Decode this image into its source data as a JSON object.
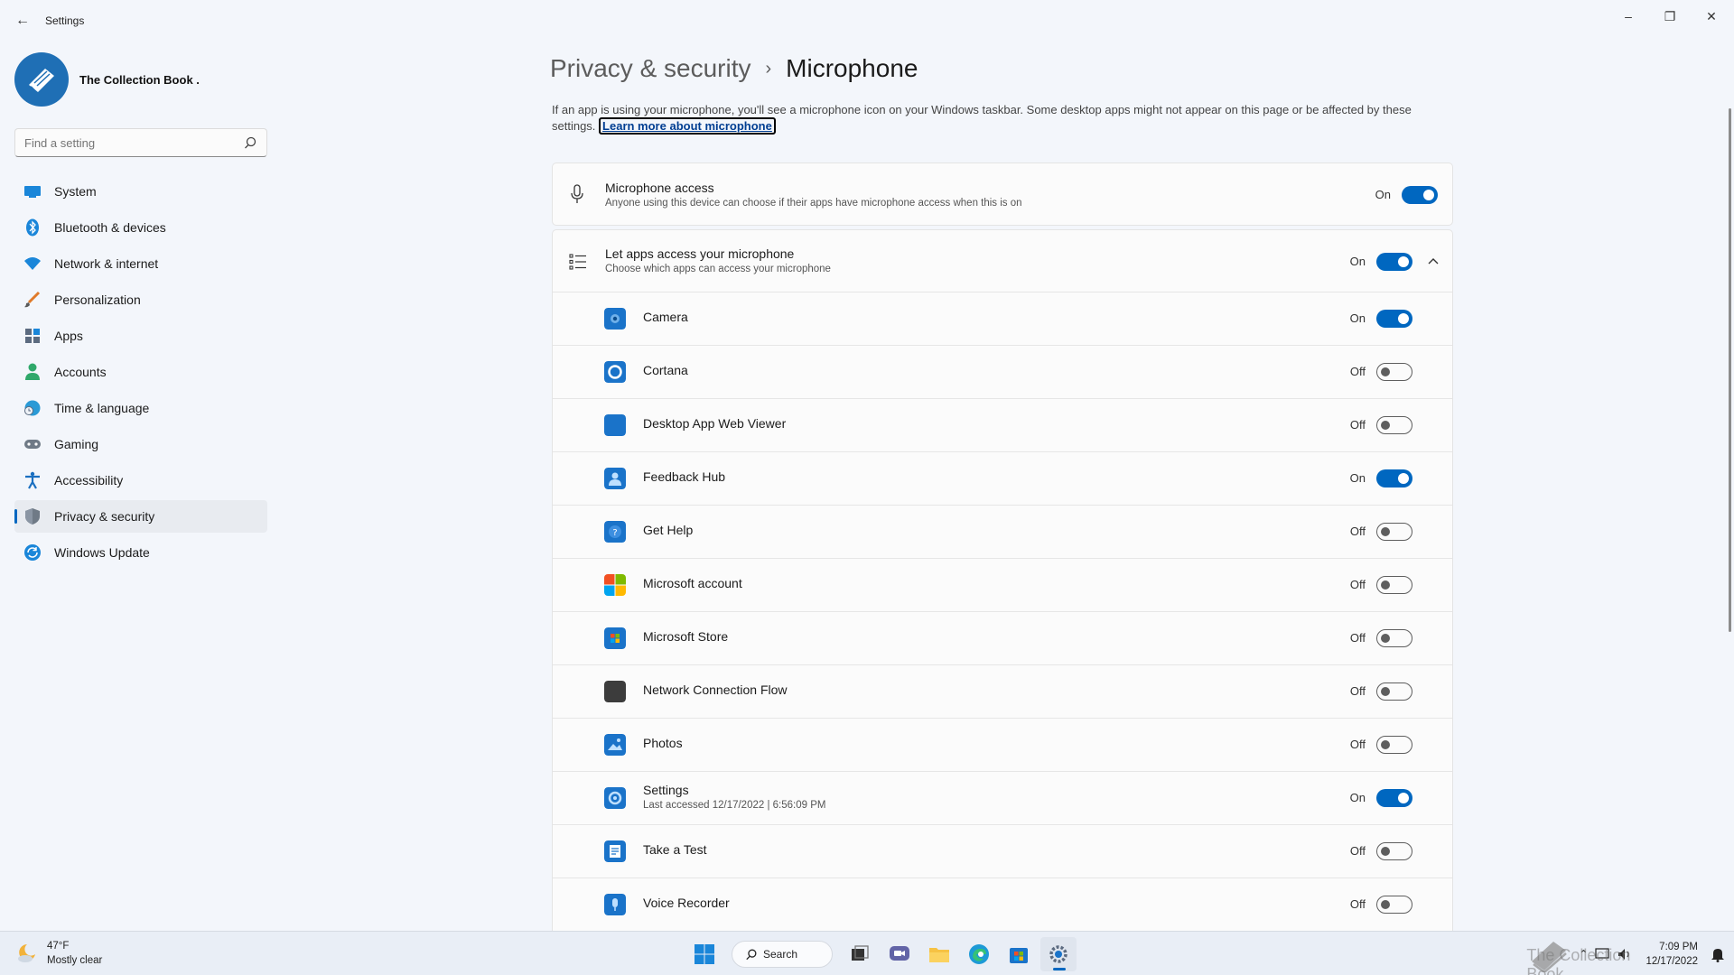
{
  "window": {
    "title": "Settings",
    "controls": {
      "minimize": "–",
      "restore": "❐",
      "close": "✕"
    }
  },
  "profile": {
    "name": "The Collection Book ."
  },
  "search": {
    "placeholder": "Find a setting"
  },
  "nav": {
    "items": [
      {
        "label": "System",
        "icon": "monitor-icon",
        "color": "#1a86d9"
      },
      {
        "label": "Bluetooth & devices",
        "icon": "bluetooth-icon",
        "color": "#1a86d9"
      },
      {
        "label": "Network & internet",
        "icon": "wifi-icon",
        "color": "#1a86d9"
      },
      {
        "label": "Personalization",
        "icon": "brush-icon",
        "color": "#e07a2a"
      },
      {
        "label": "Apps",
        "icon": "apps-icon",
        "color": "#5c6b80"
      },
      {
        "label": "Accounts",
        "icon": "person-icon",
        "color": "#2fa86a"
      },
      {
        "label": "Time & language",
        "icon": "globe-clock-icon",
        "color": "#2a9ad6"
      },
      {
        "label": "Gaming",
        "icon": "gamepad-icon",
        "color": "#6f7a86"
      },
      {
        "label": "Accessibility",
        "icon": "accessibility-icon",
        "color": "#1a6fc0"
      },
      {
        "label": "Privacy & security",
        "icon": "shield-icon",
        "color": "#6f7a86"
      },
      {
        "label": "Windows Update",
        "icon": "update-icon",
        "color": "#1a86d9"
      }
    ],
    "active_index": 9
  },
  "breadcrumb": {
    "parent": "Privacy & security",
    "separator": "›",
    "current": "Microphone"
  },
  "description": {
    "text": "If an app is using your microphone, you'll see a microphone icon on your Windows taskbar. Some desktop apps might not appear on this page or be affected by these settings.",
    "link": "Learn more about microphone"
  },
  "microphone_access": {
    "title": "Microphone access",
    "subtitle": "Anyone using this device can choose if their apps have microphone access when this is on",
    "state": "On"
  },
  "let_apps": {
    "title": "Let apps access your microphone",
    "subtitle": "Choose which apps can access your microphone",
    "state": "On"
  },
  "apps": [
    {
      "name": "Camera",
      "state": "On",
      "icon_color": "#1a73c9",
      "sub": ""
    },
    {
      "name": "Cortana",
      "state": "Off",
      "icon_color": "#1a73c9",
      "sub": ""
    },
    {
      "name": "Desktop App Web Viewer",
      "state": "Off",
      "icon_color": "#1a73c9",
      "sub": ""
    },
    {
      "name": "Feedback Hub",
      "state": "On",
      "icon_color": "#1a73c9",
      "sub": ""
    },
    {
      "name": "Get Help",
      "state": "Off",
      "icon_color": "#1a73c9",
      "sub": ""
    },
    {
      "name": "Microsoft account",
      "state": "Off",
      "icon_color": "#f25022",
      "sub": ""
    },
    {
      "name": "Microsoft Store",
      "state": "Off",
      "icon_color": "#1a73c9",
      "sub": ""
    },
    {
      "name": "Network Connection Flow",
      "state": "Off",
      "icon_color": "#3c3c3c",
      "sub": ""
    },
    {
      "name": "Photos",
      "state": "Off",
      "icon_color": "#1a73c9",
      "sub": ""
    },
    {
      "name": "Settings",
      "state": "On",
      "icon_color": "#1a73c9",
      "sub": "Last accessed 12/17/2022  |  6:56:09 PM"
    },
    {
      "name": "Take a Test",
      "state": "Off",
      "icon_color": "#1a73c9",
      "sub": ""
    },
    {
      "name": "Voice Recorder",
      "state": "Off",
      "icon_color": "#1a73c9",
      "sub": ""
    }
  ],
  "taskbar": {
    "weather_temp": "47°F",
    "weather_desc": "Mostly clear",
    "search_label": "Search",
    "time": "7:09 PM",
    "date": "12/17/2022",
    "watermark": "The Collection Book"
  },
  "colors": {
    "accent": "#0067c0",
    "background": "#f3f6fb"
  }
}
